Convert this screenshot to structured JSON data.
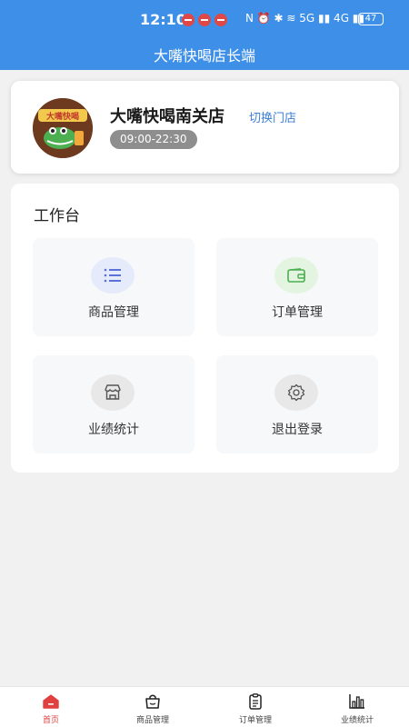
{
  "status_bar": {
    "time": "12:10",
    "icons": "N ⏰ ✱ ≋ 5G ▮▮ 4G ▮▮",
    "battery": "47"
  },
  "header": {
    "title": "大嘴快喝店长端"
  },
  "store": {
    "name": "大嘴快喝南关店",
    "switch_label": "切换门店",
    "hours": "09:00-22:30",
    "logo_text": "大嘴快喝"
  },
  "workbench": {
    "title": "工作台",
    "tiles": [
      {
        "label": "商品管理",
        "icon": "list-icon"
      },
      {
        "label": "订单管理",
        "icon": "wallet-icon"
      },
      {
        "label": "业绩统计",
        "icon": "store-icon"
      },
      {
        "label": "退出登录",
        "icon": "gear-icon"
      }
    ]
  },
  "tabs": [
    {
      "label": "首页",
      "icon": "home-icon",
      "active": true
    },
    {
      "label": "商品管理",
      "icon": "bag-icon",
      "active": false
    },
    {
      "label": "订单管理",
      "icon": "clipboard-icon",
      "active": false
    },
    {
      "label": "业绩统计",
      "icon": "bar-chart-icon",
      "active": false
    }
  ],
  "colors": {
    "primary": "#3d8fe8",
    "link": "#3d7fd6",
    "active_tab": "#e04040"
  }
}
